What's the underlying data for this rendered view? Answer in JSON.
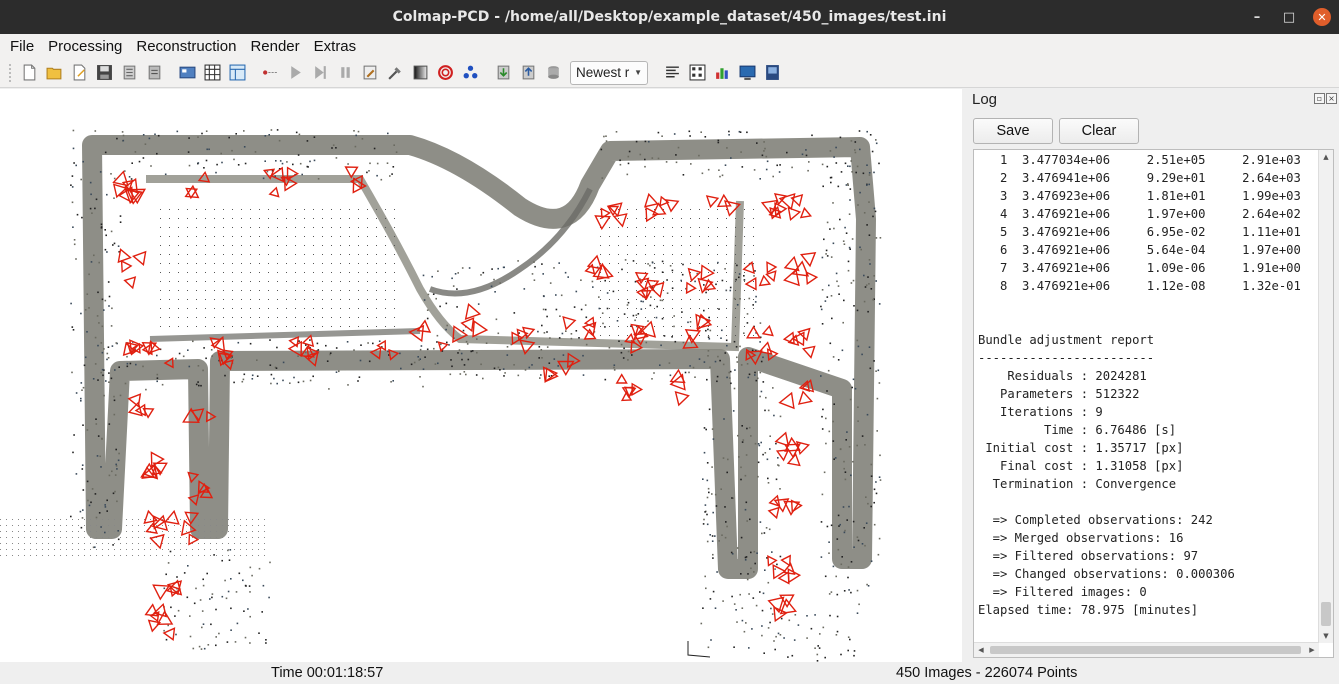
{
  "window": {
    "title": "Colmap-PCD - /home/all/Desktop/example_dataset/450_images/test.ini",
    "minimize": "–",
    "maximize": "□",
    "close": "✕"
  },
  "menu": [
    "File",
    "Processing",
    "Reconstruction",
    "Render",
    "Extras"
  ],
  "toolbar": {
    "combo_value": "Newest r",
    "icons": [
      "new-project",
      "open-project",
      "edit-project",
      "save-project",
      "import",
      "export",
      "camera-view",
      "grid",
      "table",
      "start-reconstruction",
      "play",
      "step",
      "pause",
      "pipeline",
      "tools",
      "contrast",
      "target",
      "clusters",
      "import-model",
      "export-model",
      "database",
      "log",
      "match-matrix",
      "statistics",
      "display",
      "save-image"
    ]
  },
  "colors": {
    "camera_red": "#e02010",
    "structure_gray": "#7a7a72",
    "titlebar": "#2c2c2c",
    "close_button": "#e05e2b"
  },
  "log": {
    "title": "Log",
    "save_label": "Save",
    "clear_label": "Clear",
    "lines": [
      "   1  3.477034e+06     2.51e+05     2.91e+03",
      "   2  3.476941e+06     9.29e+01     2.64e+03",
      "   3  3.476923e+06     1.81e+01     1.99e+03",
      "   4  3.476921e+06     1.97e+00     2.64e+02",
      "   5  3.476921e+06     6.95e-02     1.11e+01",
      "   6  3.476921e+06     5.64e-04     1.97e+00",
      "   7  3.476921e+06     1.09e-06     1.91e+00",
      "   8  3.476921e+06     1.12e-08     1.32e-01",
      "",
      "",
      "Bundle adjustment report",
      "------------------------",
      "    Residuals : 2024281",
      "   Parameters : 512322",
      "   Iterations : 9",
      "         Time : 6.76486 [s]",
      " Initial cost : 1.35717 [px]",
      "   Final cost : 1.31058 [px]",
      "  Termination : Convergence",
      "",
      "  => Completed observations: 242",
      "  => Merged observations: 16",
      "  => Filtered observations: 97",
      "  => Changed observations: 0.000306",
      "  => Filtered images: 0",
      "Elapsed time: 78.975 [minutes]"
    ]
  },
  "status": {
    "time": "Time 00:01:18:57",
    "summary": "450 Images - 226074 Points"
  }
}
